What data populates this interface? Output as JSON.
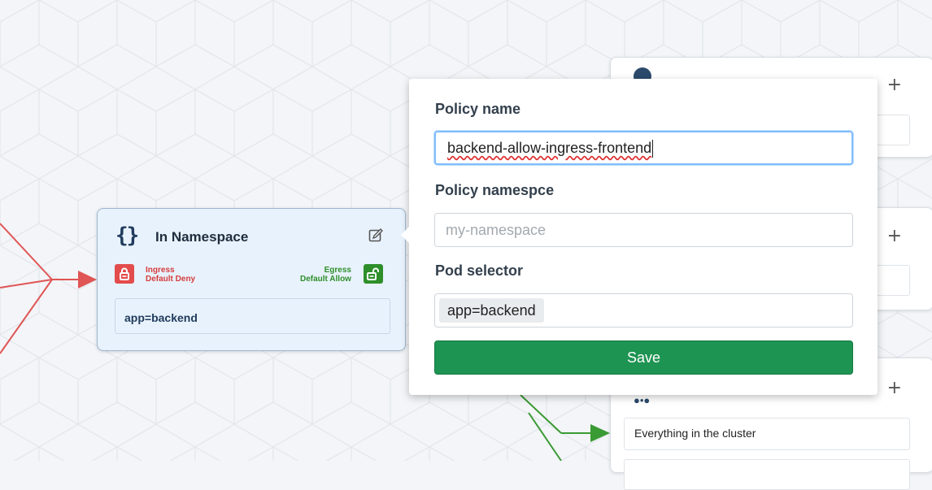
{
  "namespace_node": {
    "title": "In Namespace",
    "ingress_label": "Ingress",
    "ingress_policy": "Default Deny",
    "egress_label": "Egress",
    "egress_policy": "Default Allow",
    "pod_selector": "app=backend"
  },
  "popover": {
    "policy_name_label": "Policy name",
    "policy_name_value": "backend-allow-ingress-frontend",
    "policy_namespace_label": "Policy namespce",
    "policy_namespace_placeholder": "my-namespace",
    "pod_selector_label": "Pod selector",
    "pod_selector_tag": "app=backend",
    "save_label": "Save"
  },
  "right_cards": {
    "plus_label": "+",
    "cluster_selector": "Everything in the cluster"
  },
  "colors": {
    "ingress_deny": "#e34c4c",
    "egress_allow": "#2e8f2a",
    "save_button": "#1e9452",
    "edge_red": "#e05555",
    "edge_green": "#3a9a33"
  }
}
